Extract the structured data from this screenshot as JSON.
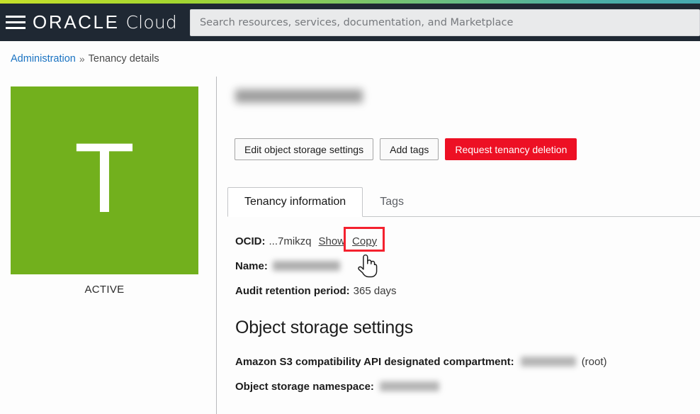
{
  "header": {
    "menu_icon": "hamburger-menu-icon",
    "brand_primary": "ORACLE",
    "brand_secondary": "Cloud",
    "search_placeholder": "Search resources, services, documentation, and Marketplace",
    "search_value": ""
  },
  "breadcrumb": {
    "parent": "Administration",
    "separator": "»",
    "current": "Tenancy details"
  },
  "left_panel": {
    "avatar_letter": "T",
    "avatar_color": "#72b01d",
    "status": "ACTIVE"
  },
  "page": {
    "title": "",
    "title_redacted": true
  },
  "toolbar": {
    "edit_storage_label": "Edit object storage settings",
    "add_tags_label": "Add tags",
    "request_deletion_label": "Request tenancy deletion",
    "danger_color": "#ed1024"
  },
  "tabs": [
    {
      "label": "Tenancy information",
      "active": true
    },
    {
      "label": "Tags",
      "active": false
    }
  ],
  "tenancy_info": {
    "ocid_label": "OCID:",
    "ocid_value": "...7mikzq",
    "show_label": "Show",
    "copy_label": "Copy",
    "name_label": "Name:",
    "name_value": "",
    "name_redacted": true,
    "audit_label": "Audit retention period:",
    "audit_value": "365 days"
  },
  "object_storage": {
    "heading": "Object storage settings",
    "s3_label": "Amazon S3 compatibility API designated compartment:",
    "s3_value": "",
    "s3_redacted": true,
    "s3_suffix": "(root)",
    "namespace_label": "Object storage namespace:",
    "namespace_value": "",
    "namespace_redacted": true
  },
  "annotation": {
    "highlight_target": "copy-link",
    "highlight_color": "#f4212e",
    "cursor_icon": "pointing-hand-cursor"
  }
}
